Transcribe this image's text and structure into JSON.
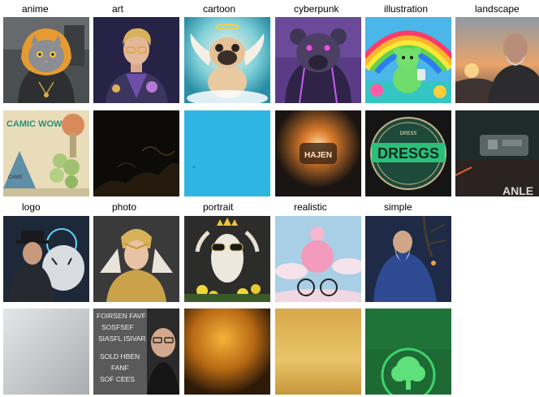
{
  "categories": [
    {
      "id": "anime",
      "label": "anime"
    },
    {
      "id": "art",
      "label": "art"
    },
    {
      "id": "cartoon",
      "label": "cartoon"
    },
    {
      "id": "cyberpunk",
      "label": "cyberpunk"
    },
    {
      "id": "illustration",
      "label": "illustration"
    },
    {
      "id": "landscape",
      "label": "landscape"
    },
    {
      "id": "logo",
      "label": "logo"
    },
    {
      "id": "photo",
      "label": "photo"
    },
    {
      "id": "portrait",
      "label": "portrait"
    },
    {
      "id": "realistic",
      "label": "realistic"
    },
    {
      "id": "simple",
      "label": "simple"
    }
  ],
  "tile_text": {
    "comic_title": "CAMIC WOWIE",
    "comic_sub": "CAME",
    "neon_text": "HAJEN",
    "dress_top": "DRESS",
    "dress_main": "DRESGS",
    "scifi_text": "ANLE",
    "type_lines": [
      "FOIRSEN FAVF",
      "SOSFSEF",
      "SIASFL ISIVAR",
      "SOLD HBEN",
      "FANF",
      "SOF CEES"
    ]
  }
}
